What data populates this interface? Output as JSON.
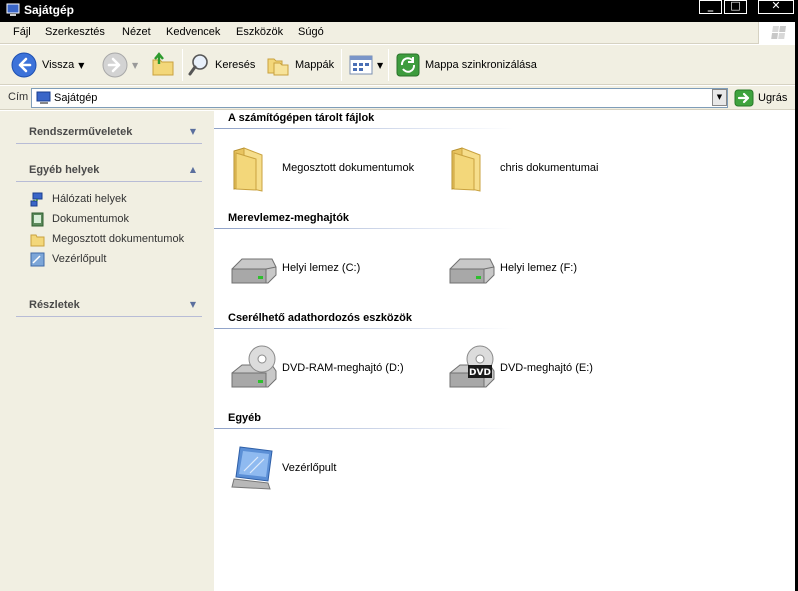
{
  "window": {
    "title": "Sajátgép"
  },
  "menubar": {
    "items": [
      "Fájl",
      "Szerkesztés",
      "Nézet",
      "Kedvencek",
      "Eszközök",
      "Súgó"
    ]
  },
  "toolbar": {
    "back_label": "Vissza",
    "search_label": "Keresés",
    "folders_label": "Mappák",
    "sync_label": "Mappa szinkronizálása"
  },
  "address": {
    "label": "Cím",
    "value": "Sajátgép",
    "go_label": "Ugrás"
  },
  "left_panel": {
    "system_tasks": {
      "title": "Rendszerműveletek"
    },
    "other_places": {
      "title": "Egyéb helyek",
      "items": [
        "Hálózati helyek",
        "Dokumentumok",
        "Megosztott dokumentumok",
        "Vezérlőpult"
      ]
    },
    "details": {
      "title": "Részletek"
    }
  },
  "content": {
    "groups": [
      {
        "title": "A számítógépen tárolt fájlok",
        "items": [
          "Megosztott dokumentumok",
          "chris dokumentumai"
        ]
      },
      {
        "title": "Merevlemez-meghajtók",
        "items": [
          "Helyi lemez (C:)",
          "Helyi lemez (F:)"
        ]
      },
      {
        "title": "Cserélhető adathordozós eszközök",
        "items": [
          "DVD-RAM-meghajtó (D:)",
          "DVD-meghajtó (E:)"
        ]
      },
      {
        "title": "Egyéb",
        "items": [
          "Vezérlőpult"
        ]
      }
    ],
    "dvd_badge": "DVD"
  }
}
